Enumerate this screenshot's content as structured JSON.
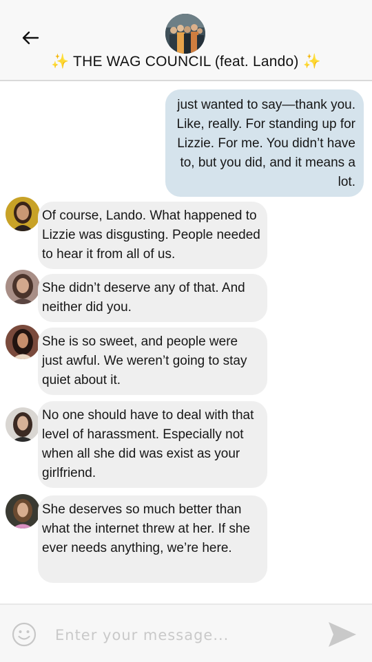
{
  "header": {
    "title": "THE WAG COUNCIL (feat. Lando)",
    "title_emoji": "✨",
    "back_icon": "back-arrow-icon"
  },
  "messages": [
    {
      "sender": "me",
      "text": "just wanted to say—thank you. Like, really. For standing up for Lizzie. For me. You didn’t have to, but you did, and it means a lot."
    },
    {
      "sender": "member",
      "avatar_color": "#c8a227",
      "text": "Of course, Lando. What happened to Lizzie was disgusting. People needed to hear it from all of us."
    },
    {
      "sender": "member",
      "avatar_color": "#a88e86",
      "text": "She didn’t deserve any of that. And neither did you."
    },
    {
      "sender": "member",
      "avatar_color": "#7a4a3c",
      "text": "She is so sweet, and people were just awful. We weren’t going to stay quiet about it."
    },
    {
      "sender": "member",
      "avatar_color": "#b7b2ad",
      "text": "No one should have to deal with that level of harassment. Especially not when all she did was exist as your girlfriend."
    },
    {
      "sender": "member",
      "avatar_color": "#3a3a32",
      "text": "She deserves so much better than what the internet threw at her. If she ever needs anything, we’re here."
    }
  ],
  "composer": {
    "placeholder": "Enter your message...",
    "emoji_icon": "smiley-icon",
    "send_icon": "send-icon"
  },
  "colors": {
    "sent_bubble": "#d5e3ec",
    "received_bubble": "#efefef",
    "header_bg": "#f8f8f8"
  }
}
